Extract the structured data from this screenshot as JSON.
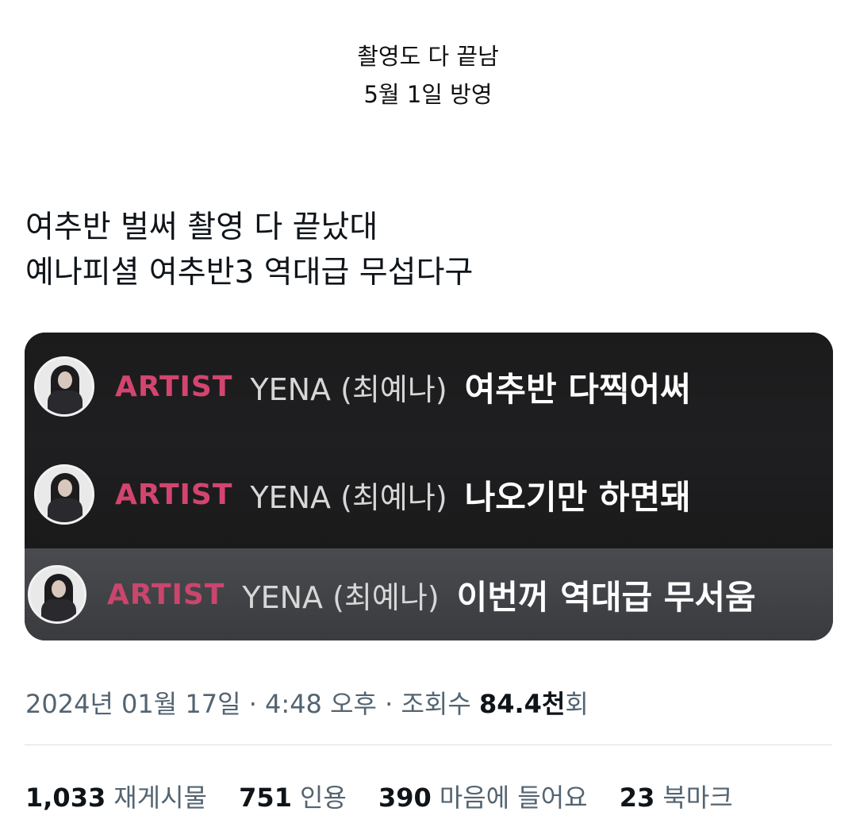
{
  "caption": {
    "line1": "촬영도 다 끝남",
    "line2": "5월 1일 방영"
  },
  "tweet": {
    "lines": [
      "여추반 벌써 촬영 다 끝났대",
      "예나피셜 여추반3 역대급 무섭다구"
    ]
  },
  "media": {
    "messages": [
      {
        "tag": "ARTIST",
        "name": "YENA (최예나)",
        "text": "여추반 다찍어써",
        "avatar": "profile-photo-icon"
      },
      {
        "tag": "ARTIST",
        "name": "YENA (최예나)",
        "text": "나오기만 하면돼",
        "avatar": "profile-photo-icon"
      },
      {
        "tag": "ARTIST",
        "name": "YENA (최예나)",
        "text": "이번꺼 역대급 무서움",
        "avatar": "profile-photo-icon"
      }
    ],
    "colors": {
      "tag": "#d3456f",
      "highlight_row": "#45464a",
      "dark_row": "#1d1d1f"
    }
  },
  "meta": {
    "timestamp": "2024년 01월 17일 · 4:48 오후 · 조회수 ",
    "views_number": "84.4천",
    "views_suffix": "회"
  },
  "stats": [
    {
      "number": "1,033",
      "label": "재게시물"
    },
    {
      "number": "751",
      "label": "인용"
    },
    {
      "number": "390",
      "label": "마음에 들어요"
    },
    {
      "number": "23",
      "label": "북마크"
    }
  ]
}
